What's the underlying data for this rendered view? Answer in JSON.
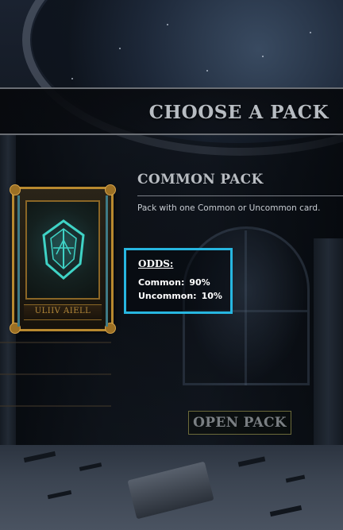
{
  "header": {
    "title": "CHOOSE A PACK"
  },
  "pack": {
    "name": "COMMON PACK",
    "description": "Pack with one Common or Uncommon card.",
    "card_label": "ULIIV AIELL",
    "card_icon": "rune-emblem-icon"
  },
  "odds": {
    "title": "ODDS:",
    "rows": [
      {
        "label": "Common:",
        "value": "90%"
      },
      {
        "label": "Uncommon:",
        "value": "10%"
      }
    ],
    "highlight_color": "#27b6e0"
  },
  "actions": {
    "open_label": "OPEN PACK"
  },
  "colors": {
    "card_border": "#b8892f",
    "emblem": "#3fd3c6",
    "title_text": "#b7bcc2"
  }
}
